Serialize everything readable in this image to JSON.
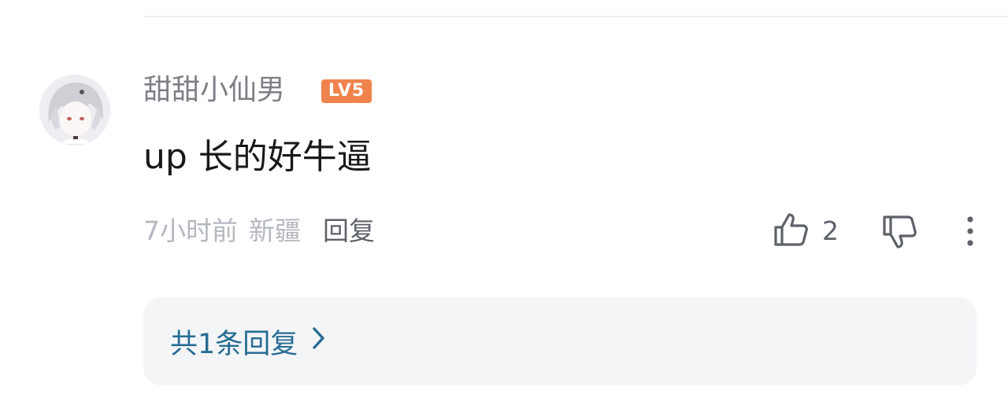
{
  "comment": {
    "username": "甜甜小仙男",
    "level_badge": "LV5",
    "text": "up 长的好牛逼",
    "time": "7小时前",
    "location": "新疆",
    "reply_label": "回复",
    "like_count": "2"
  },
  "replies": {
    "summary": "共1条回复"
  },
  "icons": {
    "like": "thumbs-up-icon",
    "dislike": "thumbs-down-icon",
    "more": "more-vertical-icon",
    "chevron": "chevron-right-icon"
  },
  "colors": {
    "level_badge": "#f0834b",
    "replies_link": "#266c92",
    "replies_box_bg": "#f4f5f7"
  }
}
